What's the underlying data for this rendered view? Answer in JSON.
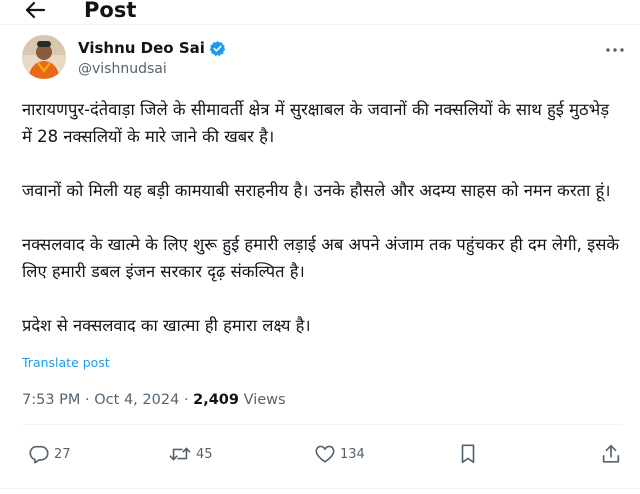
{
  "header": {
    "title": "Post",
    "back_icon": "arrow-left-icon"
  },
  "author": {
    "name": "Vishnu Deo Sai",
    "handle": "@vishnudsai",
    "verified_icon": "verified-badge-icon",
    "verified_color": "#1d9bf0"
  },
  "tweet": {
    "paragraphs": [
      "नारायणपुर-दंतेवाड़ा जिले के सीमावर्ती क्षेत्र में सुरक्षाबल के जवानों की नक्सलियों के साथ हुई मुठभेड़ में 28 नक्सलियों के मारे जाने की खबर है।",
      "जवानों को मिली यह बड़ी कामयाबी सराहनीय है। उनके हौसले और अदम्य साहस को नमन करता हूं।",
      "नक्सलवाद के खात्मे के लिए शुरू हुई हमारी लड़ाई अब अपने अंजाम तक पहुंचकर ही दम लेगी, इसके लिए हमारी डबल इंजन सरकार दृढ़ संकल्पित है।",
      "प्रदेश से नक्सलवाद का खात्मा ही हमारा लक्ष्य है।"
    ],
    "translate_label": "Translate post"
  },
  "meta": {
    "time": "7:53 PM",
    "separator": " · ",
    "date": "Oct 4, 2024",
    "views_count": "2,409",
    "views_label": " Views"
  },
  "actions": {
    "replies": "27",
    "reposts": "45",
    "likes": "134"
  },
  "colors": {
    "text": "#0f1419",
    "muted": "#536471",
    "link": "#1d9bf0",
    "divider": "#eff3f4"
  }
}
